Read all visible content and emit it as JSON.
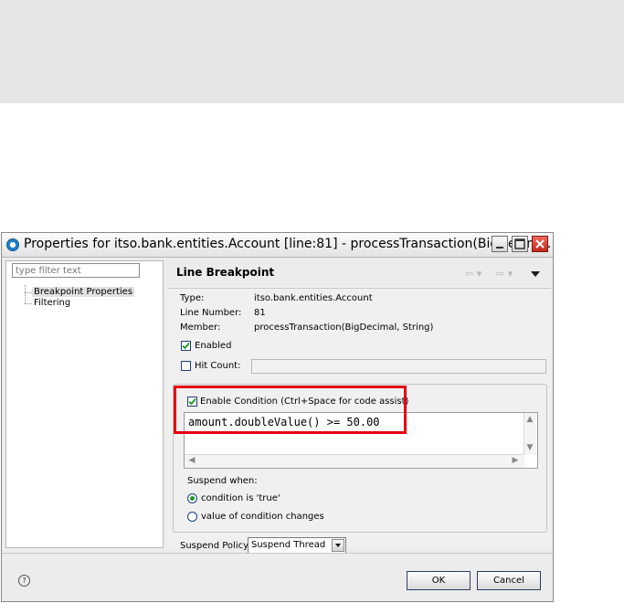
{
  "window": {
    "title": "Properties for itso.bank.entities.Account [line:81] - processTransaction(BigDecim..."
  },
  "left_pane": {
    "filter_placeholder": "type filter text",
    "tree": [
      {
        "label": "Breakpoint Properties",
        "selected": true
      },
      {
        "label": "Filtering",
        "selected": false
      }
    ]
  },
  "right_pane": {
    "header_title": "Line Breakpoint",
    "type_label": "Type:",
    "type_value": "itso.bank.entities.Account",
    "line_label": "Line Number:",
    "line_value": "81",
    "member_label": "Member:",
    "member_value": "processTransaction(BigDecimal, String)",
    "enabled_label": "Enabled",
    "enabled_checked": true,
    "hitcount_label": "Hit Count:",
    "hitcount_checked": false,
    "condition_label": "Enable Condition (Ctrl+Space for code assist)",
    "condition_checked": true,
    "condition_code": "amount.doubleValue() >= 50.00",
    "suspend_when_label": "Suspend when:",
    "suspend_options": [
      "condition is 'true'",
      "value of condition changes"
    ],
    "suspend_selected": "condition is 'true'",
    "suspend_policy_label": "Suspend Policy:",
    "suspend_policy_value": "Suspend Thread"
  },
  "footer": {
    "ok_label": "OK",
    "cancel_label": "Cancel",
    "help_icon": "?"
  },
  "colors": {
    "highlight": "#e50012",
    "close_button": "#d0372a"
  }
}
